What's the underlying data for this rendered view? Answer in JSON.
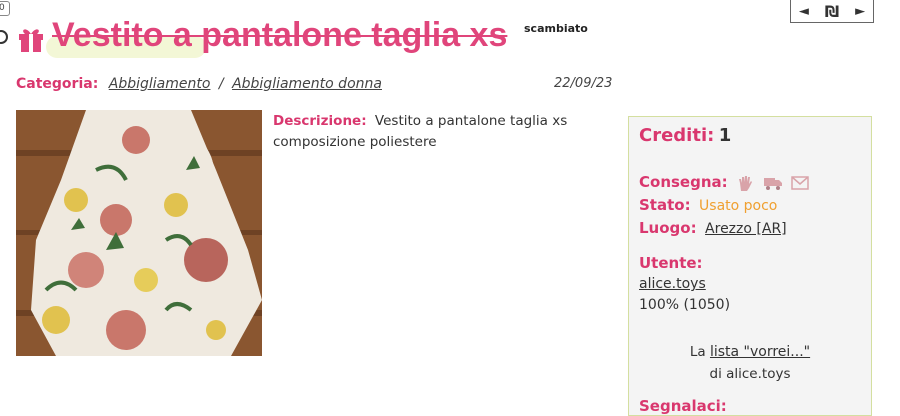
{
  "badge": "0",
  "title": "Vestito a pantalone taglia xs",
  "status_label": "scambiato",
  "nav": {
    "prev": "◄",
    "logo": "₪",
    "next": "►"
  },
  "category": {
    "label": "Categoria:",
    "main": "Abbigliamento",
    "sub": "Abbigliamento donna"
  },
  "date": "22/09/23",
  "description": {
    "label": "Descrizione:",
    "line1": "Vestito a pantalone taglia xs",
    "line2": "composizione poliestere"
  },
  "panel": {
    "credits_label": "Crediti:",
    "credits_value": "1",
    "delivery_label": "Consegna:",
    "delivery_icons": [
      "hand-icon",
      "truck-icon",
      "mail-icon"
    ],
    "state_label": "Stato:",
    "state_value": "Usato poco",
    "place_label": "Luogo:",
    "place_value": "Arezzo [AR]",
    "user_label": "Utente:",
    "user_name": "alice.toys",
    "user_rating": "100% (1050)",
    "wishlist_prefix": "La",
    "wishlist_link": "lista \"vorrei...\"",
    "wishlist_of": "di alice.toys",
    "report_label": "Segnalaci:"
  },
  "colors": {
    "accent": "#d9376e",
    "state": "#f0a030",
    "panel_border": "#d4dfa0"
  }
}
